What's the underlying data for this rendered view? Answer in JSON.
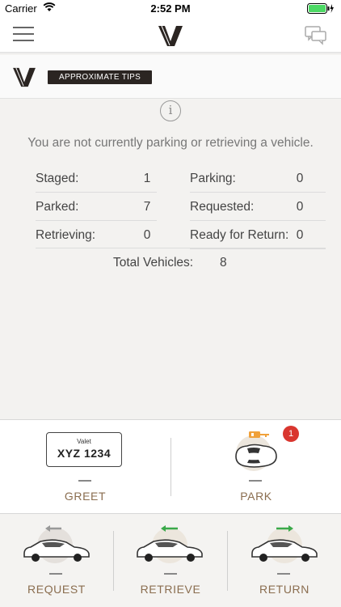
{
  "status_bar": {
    "carrier": "Carrier",
    "time": "2:52 PM"
  },
  "header": {
    "tips_label": "APPROXIMATE TIPS"
  },
  "info": {
    "message": "You are not currently parking or retrieving a vehicle."
  },
  "stats": {
    "staged_label": "Staged:",
    "staged_value": "1",
    "parked_label": "Parked:",
    "parked_value": "7",
    "retrieving_label": "Retrieving:",
    "retrieving_value": "0",
    "parking_label": "Parking:",
    "parking_value": "0",
    "requested_label": "Requested:",
    "requested_value": "0",
    "ready_label": "Ready for Return:",
    "ready_value": "0",
    "total_label": "Total Vehicles:",
    "total_value": "8"
  },
  "plate": {
    "title": "Valet",
    "number": "XYZ 1234"
  },
  "actions": {
    "greet": "GREET",
    "park": "PARK",
    "park_badge": "1",
    "request": "REQUEST",
    "retrieve": "RETRIEVE",
    "return": "RETURN"
  },
  "colors": {
    "accent": "#8a6d4f",
    "badge": "#d9362f",
    "arrow_green": "#3aa94a",
    "arrow_gray": "#999999",
    "key_orange": "#f0a13a"
  }
}
